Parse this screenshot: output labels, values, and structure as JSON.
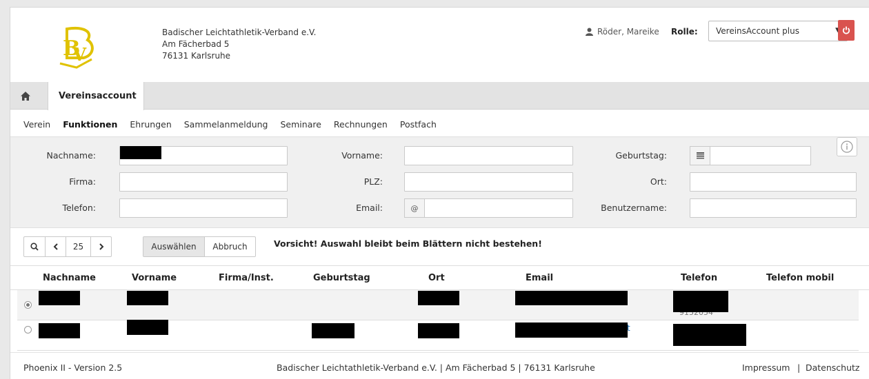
{
  "header": {
    "org_lines": [
      "Badischer Leichtathletik-Verband e.V.",
      "Am Fächerbad 5",
      "76131 Karlsruhe"
    ],
    "user_name": "Röder, Mareike",
    "role_label": "Rolle:",
    "role_value": "VereinsAccount plus",
    "logo_icon": "bbv-logo",
    "accent_color": "#d9534f",
    "logo_color": "#e0c200"
  },
  "tabs": {
    "active_label": "Vereinsaccount"
  },
  "subnav": [
    "Verein",
    "Funktionen",
    "Ehrungen",
    "Sammelanmeldung",
    "Seminare",
    "Rechnungen",
    "Postfach"
  ],
  "subnav_active": "Funktionen",
  "filters": {
    "nachname": "Nachname:",
    "vorname": "Vorname:",
    "geburtstag": "Geburtstag:",
    "firma": "Firma:",
    "plz": "PLZ:",
    "ort": "Ort:",
    "telefon": "Telefon:",
    "email": "Email:",
    "benutzername": "Benutzername:",
    "email_addon": "@"
  },
  "toolbar": {
    "page_size": "25",
    "select_label": "Auswählen",
    "cancel_label": "Abbruch",
    "warning": "Vorsicht! Auswahl bleibt beim Blättern nicht bestehen!"
  },
  "table": {
    "columns": [
      "Nachname",
      "Vorname",
      "Firma/Inst.",
      "Geburtstag",
      "Ort",
      "Email",
      "Telefon",
      "Telefon mobil"
    ],
    "row1_phone_fragment": "9152054",
    "row2_email_fragment": "t"
  },
  "footer": {
    "version": "Phoenix II - Version 2.5",
    "address": "Badischer Leichtathletik-Verband e.V. | Am Fächerbad 5 | 76131 Karlsruhe",
    "impressum": "Impressum",
    "separator": "|",
    "datenschutz": "Datenschutz"
  }
}
